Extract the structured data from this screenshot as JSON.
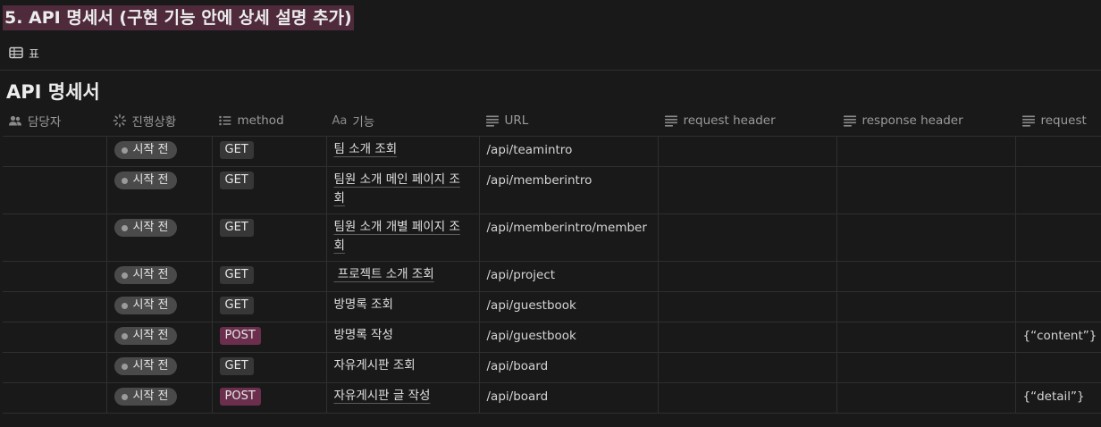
{
  "page": {
    "heading": "5. API 명세서 (구현 기능 안에 상세 설명 추가)",
    "view_tab": {
      "label": "표",
      "icon": "table-icon"
    },
    "db_title": "API 명세서"
  },
  "table": {
    "columns": [
      {
        "label": "담당자",
        "icon": "people-icon"
      },
      {
        "label": "진행상황",
        "icon": "status-spinner-icon"
      },
      {
        "label": "method",
        "icon": "list-icon"
      },
      {
        "label": "기능",
        "icon": "title-aa-icon",
        "prefix": "Aa"
      },
      {
        "label": "URL",
        "icon": "text-lines-icon"
      },
      {
        "label": "request header",
        "icon": "text-lines-icon"
      },
      {
        "label": "response header",
        "icon": "text-lines-icon"
      },
      {
        "label": "request",
        "icon": "text-lines-icon"
      }
    ],
    "rows": [
      {
        "owner": "",
        "status": "시작 전",
        "method": "GET",
        "feature": "팀 소개 조회",
        "url": "/api/teamintro",
        "request_header": "",
        "response_header": "",
        "request": ""
      },
      {
        "owner": "",
        "status": "시작 전",
        "method": "GET",
        "feature": "팀원 소개 메인 페이지 조회",
        "url": "/api/memberintro",
        "request_header": "",
        "response_header": "",
        "request": ""
      },
      {
        "owner": "",
        "status": "시작 전",
        "method": "GET",
        "feature": "팀원 소개 개별 페이지 조회",
        "url": "/api/memberintro/member",
        "request_header": "",
        "response_header": "",
        "request": ""
      },
      {
        "owner": "",
        "status": "시작 전",
        "method": "GET",
        "feature": " 프로젝트 소개 조회",
        "url": "/api/project",
        "request_header": "",
        "response_header": "",
        "request": ""
      },
      {
        "owner": "",
        "status": "시작 전",
        "method": "GET",
        "feature": "방명록 조회",
        "url": "/api/guestbook",
        "request_header": "",
        "response_header": "",
        "request": ""
      },
      {
        "owner": "",
        "status": "시작 전",
        "method": "POST",
        "feature": "방명록 작성",
        "url": "/api/guestbook",
        "request_header": "",
        "response_header": "",
        "request": "{“content”}"
      },
      {
        "owner": "",
        "status": "시작 전",
        "method": "GET",
        "feature": "자유게시판 조회",
        "url": "/api/board",
        "request_header": "",
        "response_header": "",
        "request": ""
      },
      {
        "owner": "",
        "status": "시작 전",
        "method": "POST",
        "feature": "자유게시판 글 작성",
        "url": "/api/board",
        "request_header": "",
        "response_header": "",
        "request": "{“detail”}"
      }
    ]
  },
  "colors": {
    "background": "#191919",
    "heading_highlight": "#4e2a3b",
    "status_pill": "#4a4a4a",
    "get_tag": "#373737",
    "post_tag": "#6b2f4d"
  }
}
